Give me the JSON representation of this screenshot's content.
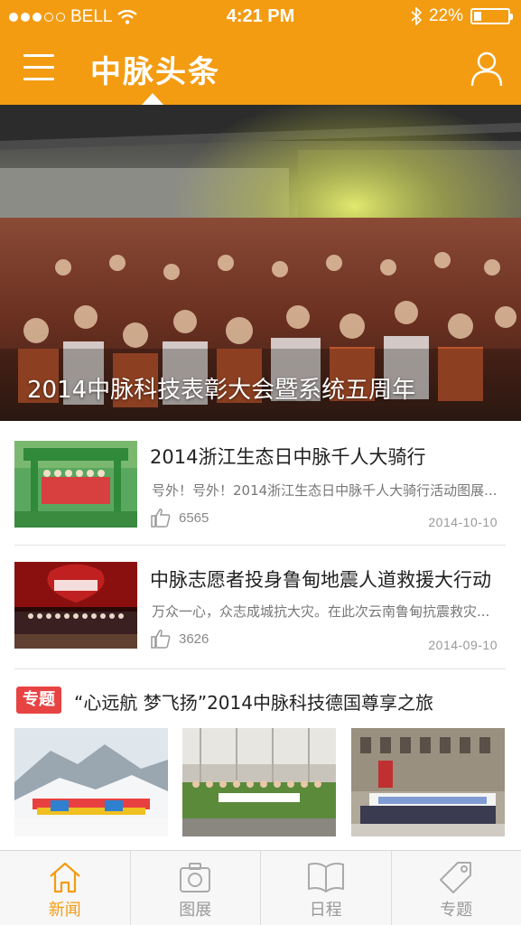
{
  "status_bar": {
    "carrier": "BELL",
    "time": "4:21 PM",
    "battery": "22%",
    "battery_level": 0.22
  },
  "nav": {
    "title": "中脉头条",
    "left_icon": "menu-icon",
    "right_icon": "user-icon"
  },
  "hero": {
    "caption": "2014中脉科技表彰大会暨系统五周年"
  },
  "news": [
    {
      "title": "2014浙江生态日中脉千人大骑行",
      "summary": "号外！号外！2014浙江生态日中脉千人大骑行活动图展...",
      "likes": "6565",
      "date": "2014-10-10"
    },
    {
      "title": "中脉志愿者投身鲁甸地震人道救援大行动",
      "summary": "万众一心，众志成城抗大灾。在此次云南鲁甸抗震救灾...",
      "likes": "3626",
      "date": "2014-09-10"
    }
  ],
  "topic": {
    "badge": "专题",
    "title": "“心远航 梦飞扬”2014中脉科技德国尊享之旅"
  },
  "tabs": [
    {
      "label": "新闻",
      "icon": "home-icon",
      "active": true
    },
    {
      "label": "图展",
      "icon": "camera-icon",
      "active": false
    },
    {
      "label": "日程",
      "icon": "book-icon",
      "active": false
    },
    {
      "label": "专题",
      "icon": "tag-icon",
      "active": false
    }
  ],
  "colors": {
    "accent": "#f39c12",
    "badge": "#e84343"
  }
}
